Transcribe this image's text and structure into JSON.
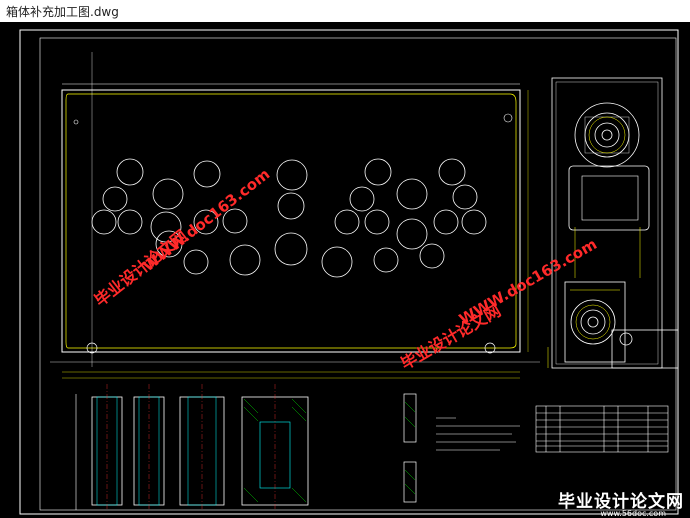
{
  "window": {
    "title": "箱体补充加工图.dwg"
  },
  "watermarks": {
    "url1": "WWW.doc163.com",
    "brand1": "毕业设计论文网",
    "url2": "WWW.doc163.com",
    "brand2": "毕业设计论文网"
  },
  "footer": {
    "brand": "毕业设计论文网",
    "site": "www.56doc.com"
  },
  "colors": {
    "background": "#000000",
    "outline": "#ffffff",
    "yellow": "#ffff00",
    "cyan": "#00ffff",
    "green": "#00ff00",
    "watermark": "#ff2a2a"
  }
}
